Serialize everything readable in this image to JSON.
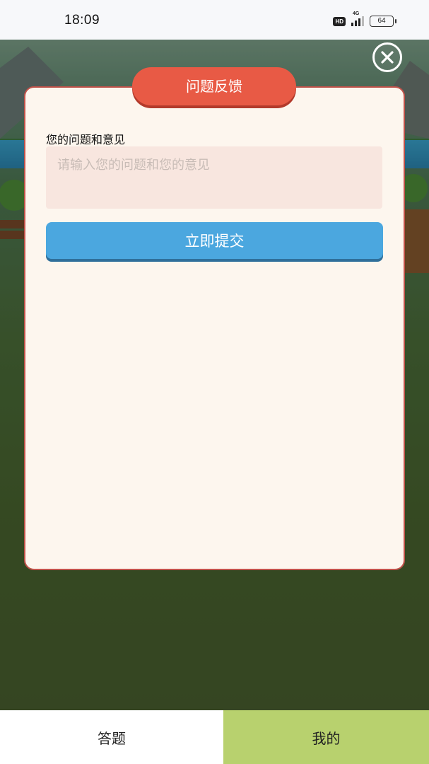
{
  "status_bar": {
    "time": "18:09",
    "hd_badge": "HD",
    "network": "4G",
    "battery": "64"
  },
  "modal": {
    "title": "问题反馈",
    "field_label": "您的问题和意见",
    "input_placeholder": "请输入您的问题和您的意见",
    "input_value": "",
    "submit_label": "立即提交"
  },
  "close_icon": "close-icon",
  "tabs": [
    {
      "label": "答题",
      "active": false
    },
    {
      "label": "我的",
      "active": true
    }
  ],
  "colors": {
    "title_red": "#e85a45",
    "submit_blue": "#4ba7df",
    "active_tab_green": "#b8d16e",
    "modal_bg": "#fdf6ee",
    "input_bg": "#f8e6df"
  }
}
